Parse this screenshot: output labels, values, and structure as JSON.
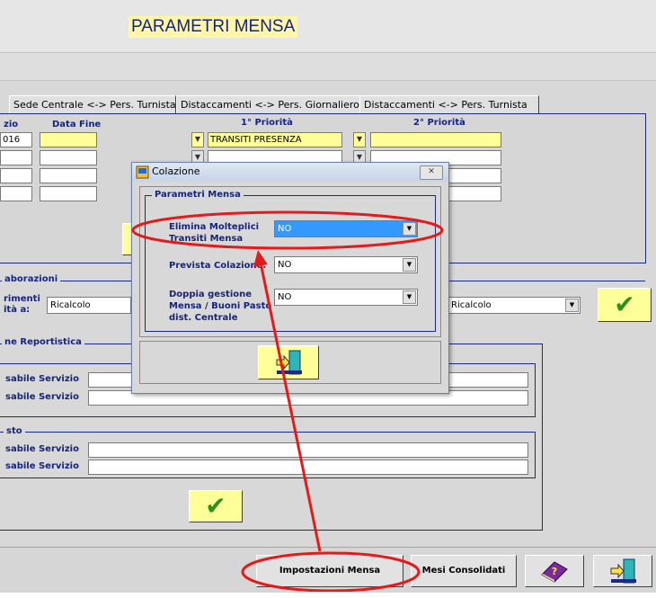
{
  "header": {
    "title": "PARAMETRI MENSA"
  },
  "tabs": [
    {
      "label": "Sede Centrale <-> Pers. Turnista"
    },
    {
      "label": "Distaccamenti <-> Pers. Giornaliero"
    },
    {
      "label": "Distaccamenti <-> Pers. Turnista"
    }
  ],
  "grid": {
    "headers": {
      "inizio": "zio",
      "fine": "Data Fine",
      "prio1": "1° Priorità",
      "prio2": "2° Priorità"
    },
    "row1": {
      "inizio": "016",
      "prio1": "TRANSITI PRESENZA"
    }
  },
  "elaborazioni": {
    "label": "aborazioni",
    "riferimenti_label_1": "rimenti",
    "riferimenti_label_2": "ità a:",
    "combo_left": "Ricalcolo",
    "combo_right": "Ricalcolo"
  },
  "reportistica": {
    "label": "ne Reportistica",
    "field1": "sabile Servizio",
    "field2": "sabile Servizio"
  },
  "pasto": {
    "label": "sto",
    "field1": "sabile Servizio",
    "field2": "sabile Servizio"
  },
  "bottom_buttons": {
    "impostazioni": "Impostazioni Mensa",
    "mesi": "Mesi Consolidati"
  },
  "dialog": {
    "title": "Colazione",
    "close_glyph": "✕",
    "group_label": "Parametri Mensa",
    "field1_label_1": "Elimina Molteplici",
    "field1_label_2": "Transiti Mensa",
    "field1_value": "NO",
    "field2_label": "Prevista Colazione:",
    "field2_value": "NO",
    "field3_label_1": "Doppia gestione",
    "field3_label_2": "Mensa / Buoni Pasto",
    "field3_label_3": "dist. Centrale",
    "field3_value": "NO"
  },
  "icons": {
    "confirm": "check-icon",
    "exit": "exit-door-icon",
    "help": "help-book-icon",
    "dropdown": "chevron-down-icon"
  },
  "colors": {
    "accent": "#17247a",
    "field_yellow": "#ffff99",
    "selection_blue": "#3399ff",
    "annotation_red": "#e21b1b"
  }
}
